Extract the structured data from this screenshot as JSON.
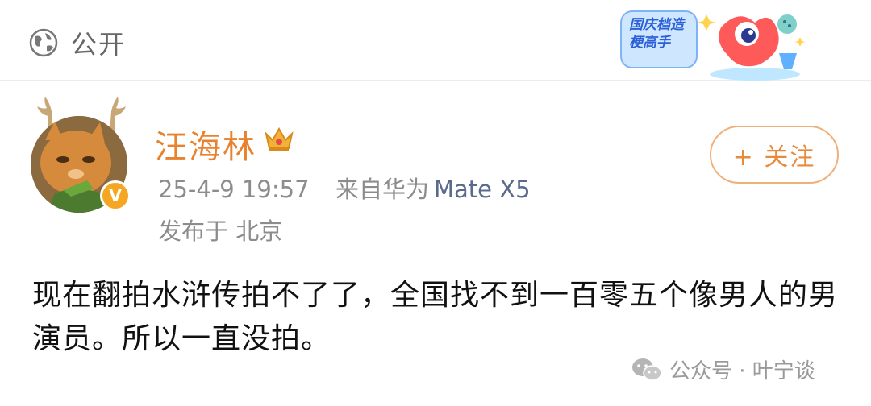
{
  "header": {
    "visibility_label": "公开",
    "visibility_icon": "globe-icon",
    "sticker_text": "国庆档造梗高手"
  },
  "post": {
    "username": "汪海林",
    "verified_badge": "V",
    "timestamp": "25-4-9 19:57",
    "source_prefix": "来自华为",
    "device": "Mate X5",
    "location": "发布于 北京",
    "follow_label": "+ 关注",
    "body": "现在翻拍水浒传拍不了了，全国找不到一百零五个像男人的男演员。所以一直没拍。"
  },
  "watermark": {
    "text": "公众号 · 叶宁谈"
  },
  "colors": {
    "username": "#e8822f",
    "follow_border": "#f0b07a",
    "meta_gray": "#8c8c8c",
    "device": "#5a6a8c"
  }
}
